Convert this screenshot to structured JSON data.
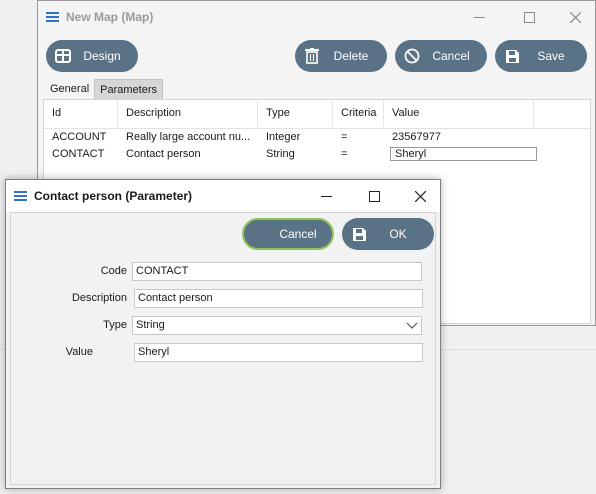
{
  "map_window": {
    "title": "New Map (Map)",
    "toolbar": {
      "design_label": "Design",
      "delete_label": "Delete",
      "cancel_label": "Cancel",
      "save_label": "Save"
    },
    "tabs": [
      {
        "label": "General",
        "active": false
      },
      {
        "label": "Parameters",
        "active": true
      }
    ],
    "grid": {
      "columns": [
        "Id",
        "Description",
        "Type",
        "Criteria",
        "Value"
      ],
      "rows": [
        {
          "id": "ACCOUNT",
          "description": "Really large account nu...",
          "type": "Integer",
          "criteria": "=",
          "value": "23567977"
        },
        {
          "id": "CONTACT",
          "description": "Contact person",
          "type": "String",
          "criteria": "=",
          "value": "Sheryl"
        }
      ]
    }
  },
  "param_dialog": {
    "title": "Contact person (Parameter)",
    "cancel_label": "Cancel",
    "ok_label": "OK",
    "fields": {
      "code_label": "Code",
      "code_value": "CONTACT",
      "description_label": "Description",
      "description_value": "Contact person",
      "type_label": "Type",
      "type_value": "String",
      "value_label": "Value",
      "value_value": "Sheryl"
    }
  },
  "icons": {
    "app": "hamburger-list-icon",
    "design": "table-grid-icon",
    "delete": "trash-icon",
    "cancel": "prohibited-circle-icon",
    "save": "floppy-disk-icon",
    "dropdown": "chevron-down-icon"
  },
  "colors": {
    "accent": "#2f73c8",
    "button": "#5a7285",
    "focus_ring": "#8fc25a"
  }
}
